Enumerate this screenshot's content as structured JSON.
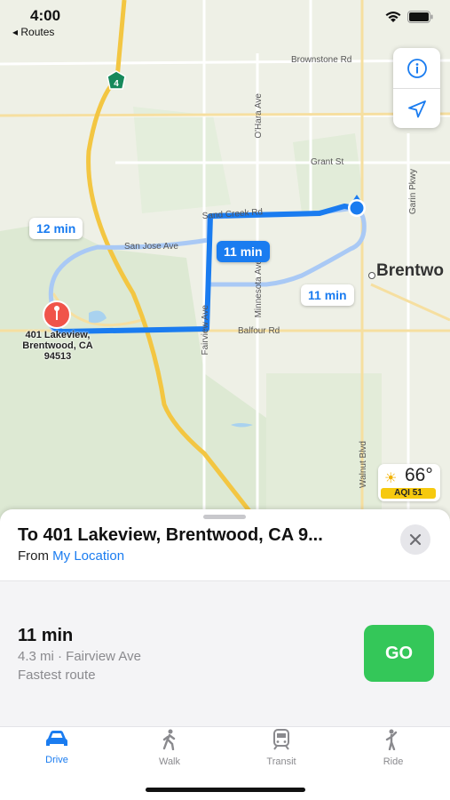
{
  "status_bar": {
    "time": "4:00",
    "back_label": "◂ Routes"
  },
  "map": {
    "labels": {
      "brownstone": "Brownstone Rd",
      "ohara": "O'Hara Ave",
      "grant": "Grant St",
      "garin": "Garin Pkwy",
      "sand_creek": "Sand Creek Rd",
      "san_jose": "San Jose Ave",
      "minnesota": "Minnesota Ave",
      "fairview": "Fairview Ave",
      "balfour": "Balfour Rd",
      "walnut": "Walnut Blvd",
      "highway": "4"
    },
    "city": "Brentwo",
    "route_badges": {
      "alt1": "12 min",
      "selected": "11 min",
      "alt2": "11 min"
    },
    "pin_label": [
      "401 Lakeview,",
      "Brentwood, CA",
      "94513"
    ],
    "weather": {
      "temp": "66°",
      "aqi": "AQI 51"
    },
    "icons": [
      "info-icon",
      "location-arrow-icon"
    ]
  },
  "sheet": {
    "title": "To 401 Lakeview, Brentwood, CA 9...",
    "from_prefix": "From",
    "from_location": "My Location",
    "route": {
      "duration": "11 min",
      "details": "4.3 mi · Fairview Ave",
      "note": "Fastest route",
      "go_label": "GO"
    },
    "tabs": [
      {
        "label": "Drive",
        "icon": "car-icon",
        "active": true
      },
      {
        "label": "Walk",
        "icon": "walk-icon",
        "active": false
      },
      {
        "label": "Transit",
        "icon": "train-icon",
        "active": false
      },
      {
        "label": "Ride",
        "icon": "ride-icon",
        "active": false
      }
    ]
  },
  "colors": {
    "accent": "#1a7cf0",
    "go": "#34c759"
  }
}
